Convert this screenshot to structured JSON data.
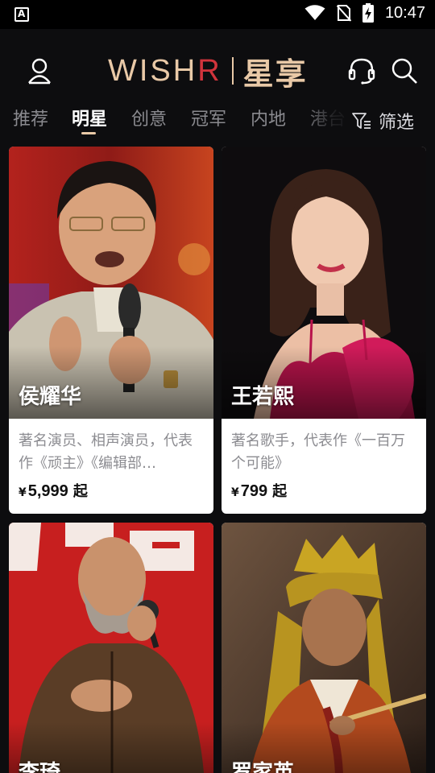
{
  "status_bar": {
    "time": "10:47",
    "left_icon": "accessibility-a-icon",
    "icons": [
      "wifi-icon",
      "no-sim-icon",
      "battery-charging-icon"
    ]
  },
  "header": {
    "logo_latin_prefix": "WISH",
    "logo_latin_accent": "R",
    "logo_cn": "星享",
    "icons": [
      "profile-icon",
      "customer-service-headset-icon",
      "search-icon"
    ],
    "colors": {
      "gold": "#e9c9a7",
      "brand_red": "#d1343c",
      "background": "#0d0d0f"
    }
  },
  "tabs": {
    "items": [
      {
        "label": "推荐",
        "active": false
      },
      {
        "label": "明星",
        "active": true
      },
      {
        "label": "创意",
        "active": false
      },
      {
        "label": "冠军",
        "active": false
      },
      {
        "label": "内地",
        "active": false
      },
      {
        "label": "港台",
        "active": false
      }
    ],
    "filter_label": "筛选",
    "filter_icon": "filter-icon"
  },
  "cards": [
    {
      "name": "侯耀华",
      "description": "著名演员、相声演员，代表作《顽主》《编辑部…",
      "currency": "¥",
      "price": "5,999",
      "suffix": "起"
    },
    {
      "name": "王若熙",
      "description": "著名歌手，代表作《一百万个可能》",
      "currency": "¥",
      "price": "799",
      "suffix": "起"
    },
    {
      "name": "李琦",
      "description": "",
      "currency": "",
      "price": "",
      "suffix": ""
    },
    {
      "name": "罗家英",
      "description": "",
      "currency": "",
      "price": "",
      "suffix": ""
    }
  ]
}
